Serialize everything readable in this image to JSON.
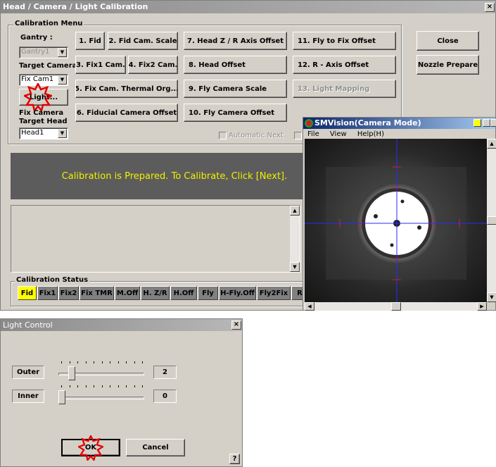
{
  "calibration_window": {
    "title": "Head / Camera / Light Calibration",
    "close_glyph": "×",
    "menu_group": "Calibration Menu",
    "gantry_label": "Gantry :",
    "gantry_value": "Gantry1",
    "target_camera_label": "Target Camera",
    "target_camera_value": "Fix Cam1",
    "light_button": "Light...",
    "fix_camera_label": "Fix Camera",
    "target_head_label": "Target Head",
    "target_head_value": "Head1",
    "buttons": {
      "b1": "1. Fid",
      "b2": "2. Fid Cam. Scale",
      "b3": "3. Fix1 Cam.",
      "b4": "4. Fix2 Cam.",
      "b5": "5. Fix Cam. Thermal Org...",
      "b6": "6. Fiducial Camera Offset",
      "b7": "7. Head Z / R Axis Offset",
      "b8": "8. Head Offset",
      "b9": "9. Fly Camera Scale",
      "b10": "10. Fly Camera Offset",
      "b11": "11. Fly to Fix Offset",
      "b12": "12. R - Axis Offset",
      "b13": "13. Light Mapping"
    },
    "close_button": "Close",
    "nozzle_button": "Nozzle Prepare",
    "automatic_next": "Automatic Next",
    "message": "Calibration is Prepared. To Calibrate, Click [Next].",
    "status_group": "Calibration Status",
    "status_items": [
      "Fid",
      "Fix1",
      "Fix2",
      "Fix TMR",
      "M.Off",
      "H. Z/R",
      "H.Off",
      "Fly",
      "H-Fly.Off",
      "Fly2Fix",
      "R"
    ],
    "scroll_up": "▲",
    "scroll_down": "▼"
  },
  "vision_window": {
    "title": "SMVision(Camera Mode)",
    "menu": [
      "File",
      "View",
      "Help(H)"
    ]
  },
  "light_window": {
    "title": "Light Control",
    "outer_label": "Outer",
    "outer_value": "2",
    "inner_label": "Inner",
    "inner_value": "0",
    "outer_level_max": 100,
    "ok_button": "OK",
    "cancel_button": "Cancel",
    "help_glyph": "?"
  },
  "colors": {
    "highlight_burst": "#e00000",
    "message_text": "#f0f000",
    "active_status": "#ffff00"
  }
}
